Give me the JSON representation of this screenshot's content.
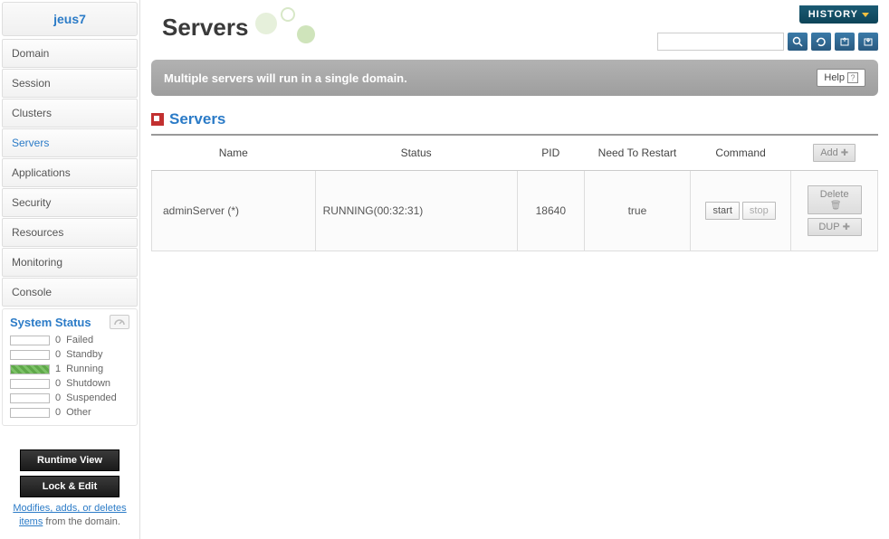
{
  "sidebar": {
    "title": "jeus7",
    "items": [
      {
        "label": "Domain",
        "active": false
      },
      {
        "label": "Session",
        "active": false
      },
      {
        "label": "Clusters",
        "active": false
      },
      {
        "label": "Servers",
        "active": true
      },
      {
        "label": "Applications",
        "active": false
      },
      {
        "label": "Security",
        "active": false
      },
      {
        "label": "Resources",
        "active": false
      },
      {
        "label": "Monitoring",
        "active": false
      },
      {
        "label": "Console",
        "active": false
      }
    ],
    "system_status": {
      "title": "System Status",
      "rows": [
        {
          "count": "0",
          "label": "Failed",
          "filled": false
        },
        {
          "count": "0",
          "label": "Standby",
          "filled": false
        },
        {
          "count": "1",
          "label": "Running",
          "filled": true
        },
        {
          "count": "0",
          "label": "Shutdown",
          "filled": false
        },
        {
          "count": "0",
          "label": "Suspended",
          "filled": false
        },
        {
          "count": "0",
          "label": "Other",
          "filled": false
        }
      ]
    },
    "runtime_view": "Runtime View",
    "lock_edit": "Lock & Edit",
    "note_link": "Modifies, adds, or deletes items",
    "note_rest": " from the domain."
  },
  "header": {
    "history": "HISTORY",
    "page_title": "Servers",
    "search_placeholder": ""
  },
  "banner": {
    "text": "Multiple servers will run in a single domain.",
    "help": "Help"
  },
  "section": {
    "title": "Servers"
  },
  "table": {
    "headers": {
      "name": "Name",
      "status": "Status",
      "pid": "PID",
      "restart": "Need To Restart",
      "command": "Command"
    },
    "add_btn": "Add",
    "rows": [
      {
        "name": "adminServer (*)",
        "status": "RUNNING(00:32:31)",
        "pid": "18640",
        "restart": "true",
        "cmd_start": "start",
        "cmd_stop": "stop",
        "delete": "Delete",
        "dup": "DUP"
      }
    ]
  }
}
